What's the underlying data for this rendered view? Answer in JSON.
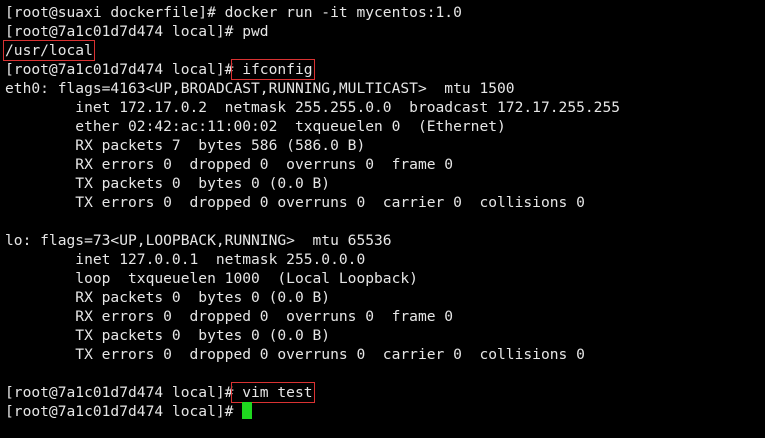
{
  "terminal": {
    "background": "#000000",
    "text_color": "#e6e6e6",
    "highlight_color": "#d93232",
    "cursor_color": "#1fd81f",
    "lines": [
      {
        "text": "[root@suaxi dockerfile]# docker run -it mycentos:1.0"
      },
      {
        "prompt": "[root@7a1c01d7d474 local]# ",
        "command": "pwd"
      },
      {
        "output": "/usr/local"
      },
      {
        "prompt": "[root@7a1c01d7d474 local]#",
        "command": " ifconfig"
      },
      {
        "text": "eth0: flags=4163<UP,BROADCAST,RUNNING,MULTICAST>  mtu 1500"
      },
      {
        "text": "        inet 172.17.0.2  netmask 255.255.0.0  broadcast 172.17.255.255"
      },
      {
        "text": "        ether 02:42:ac:11:00:02  txqueuelen 0  (Ethernet)"
      },
      {
        "text": "        RX packets 7  bytes 586 (586.0 B)"
      },
      {
        "text": "        RX errors 0  dropped 0  overruns 0  frame 0"
      },
      {
        "text": "        TX packets 0  bytes 0 (0.0 B)"
      },
      {
        "text": "        TX errors 0  dropped 0 overruns 0  carrier 0  collisions 0"
      },
      {
        "text": ""
      },
      {
        "text": "lo: flags=73<UP,LOOPBACK,RUNNING>  mtu 65536"
      },
      {
        "text": "        inet 127.0.0.1  netmask 255.0.0.0"
      },
      {
        "text": "        loop  txqueuelen 1000  (Local Loopback)"
      },
      {
        "text": "        RX packets 0  bytes 0 (0.0 B)"
      },
      {
        "text": "        RX errors 0  dropped 0  overruns 0  frame 0"
      },
      {
        "text": "        TX packets 0  bytes 0 (0.0 B)"
      },
      {
        "text": "        TX errors 0  dropped 0 overruns 0  carrier 0  collisions 0"
      },
      {
        "text": ""
      },
      {
        "prompt": "[root@7a1c01d7d474 local]#",
        "command": " vim test"
      },
      {
        "prompt": "[root@7a1c01d7d474 local]# ",
        "command": ""
      }
    ]
  }
}
